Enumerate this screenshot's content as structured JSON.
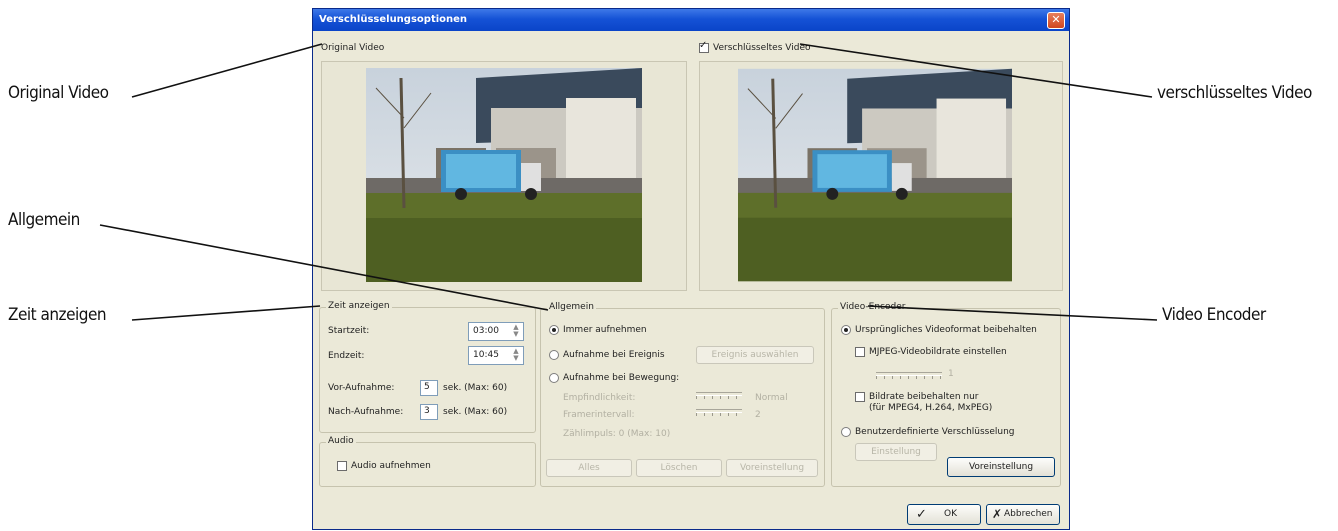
{
  "annotations": {
    "original_video": "Original Video",
    "verschluesseltes_video": "verschlüsseltes Video",
    "allgemein": "Allgemein",
    "zeit_anzeigen": "Zeit anzeigen",
    "video_encoder": "Video  Encoder"
  },
  "dialog": {
    "title": "Verschlüsselungsoptionen",
    "close": "✕",
    "original_video_label": "Original Video",
    "encrypted_video_label": "Verschlüsseltes Video",
    "encrypted_video_checked": true
  },
  "zeit": {
    "title": "Zeit anzeigen",
    "startzeit_label": "Startzeit:",
    "startzeit_value": "03:00",
    "endzeit_label": "Endzeit:",
    "endzeit_value": "10:45",
    "vor_label": "Vor-Aufnahme:",
    "vor_value": "5",
    "vor_unit": "sek. (Max: 60)",
    "nach_label": "Nach-Aufnahme:",
    "nach_value": "3",
    "nach_unit": "sek. (Max: 60)"
  },
  "audio": {
    "title": "Audio",
    "aufnehmen_label": "Audio aufnehmen"
  },
  "allgemein": {
    "title": "Allgemein",
    "immer": "Immer aufnehmen",
    "ereignis": "Aufnahme bei Ereignis",
    "ereignis_button": "Ereignis auswählen",
    "bewegung": "Aufnahme bei Bewegung:",
    "empfindlichkeit": "Empfindlichkeit:",
    "empfindlichkeit_value": "Normal",
    "framerintervall": "Framerintervall:",
    "framerintervall_value": "2",
    "zaehlimpuls": "Zählimpuls: 0 (Max: 10)",
    "alles": "Alles",
    "loeschen": "Löschen",
    "voreinstellung": "Voreinstellung"
  },
  "encoder": {
    "title": "Video-Encoder",
    "ursprungliches": "Ursprüngliches Videoformat beibehalten",
    "mjpeg": "MJPEG-Videobildrate einstellen",
    "slider_value": "1",
    "bildrate_line1": "Bildrate beibehalten nur",
    "bildrate_line2": "(für MPEG4, H.264, MxPEG)",
    "benutzer": "Benutzerdefinierte Verschlüsselung",
    "einstellung": "Einstellung",
    "voreinstellung": "Voreinstellung"
  },
  "footer": {
    "ok": "OK",
    "abbrechen": "Abbrechen"
  }
}
